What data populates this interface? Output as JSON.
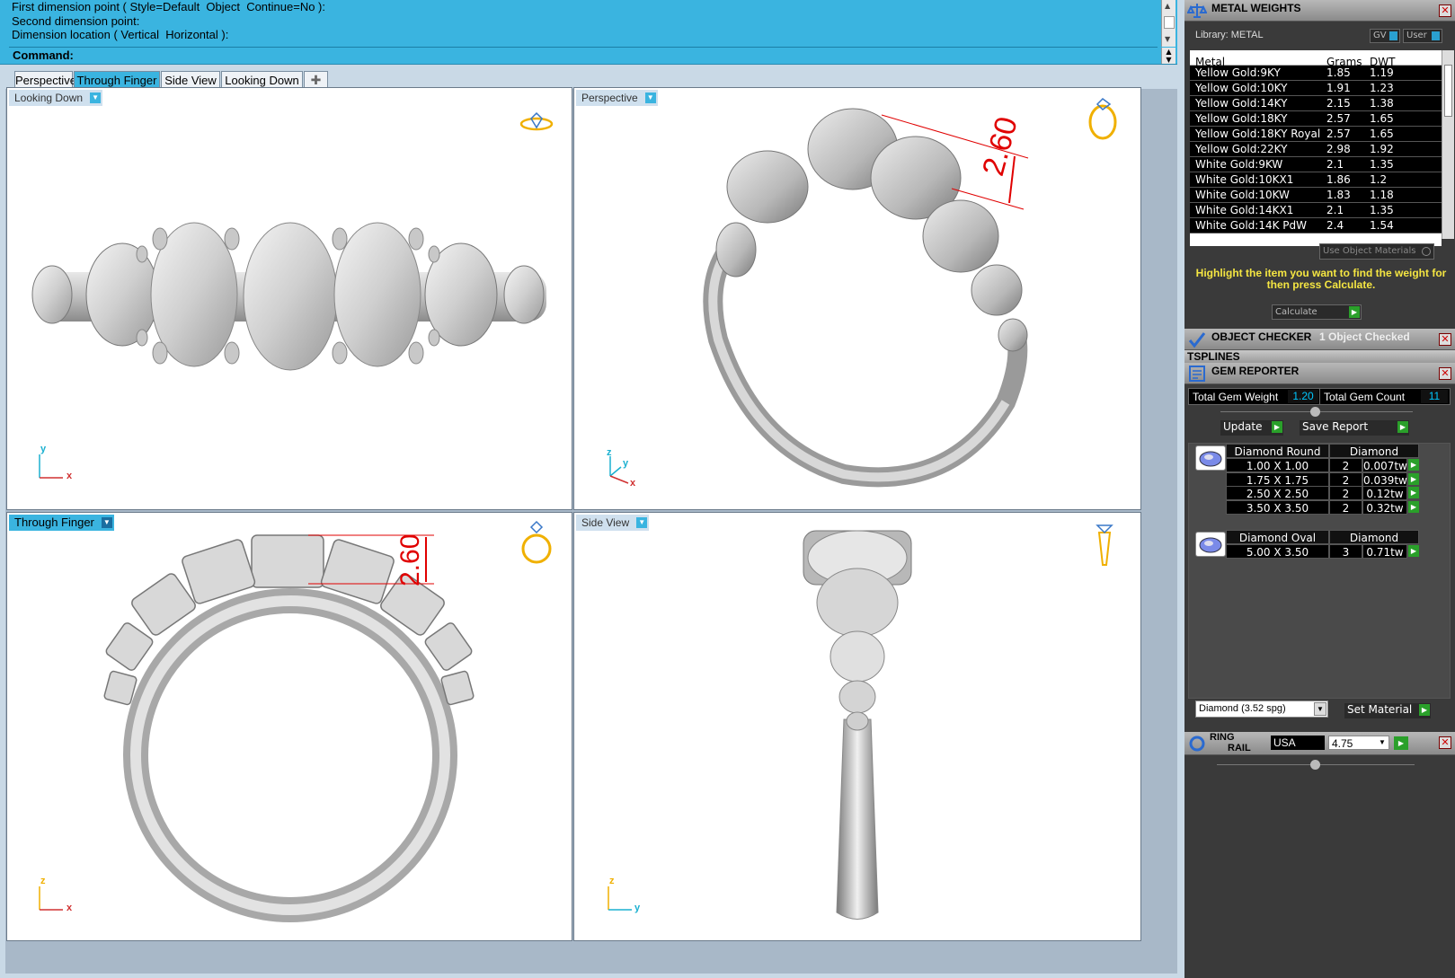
{
  "command": {
    "history": [
      "First dimension point ( Style=Default  Object  Continue=No ):",
      "Second dimension point:",
      "Dimension location ( Vertical  Horizontal ):"
    ],
    "prompt": "Command:"
  },
  "viewport_tabs": [
    "Perspective",
    "Through Finger",
    "Side View",
    "Looking Down"
  ],
  "add_tab_icon": "plus-icon",
  "viewports": {
    "top_left": {
      "label": "Looking Down",
      "axis_a": "y",
      "axis_b": "x"
    },
    "top_right": {
      "label": "Perspective",
      "axis_a": "z",
      "axis_b": "y",
      "axis_c": "x",
      "dimension": "2.60"
    },
    "bottom_left": {
      "label": "Through Finger",
      "axis_a": "z",
      "axis_b": "x",
      "dimension": "2.60"
    },
    "bottom_right": {
      "label": "Side View",
      "axis_a": "z",
      "axis_b": "y"
    }
  },
  "metal_weights": {
    "title": "METAL WEIGHTS",
    "library_label": "Library: METAL",
    "gv_label": "GV",
    "user_label": "User",
    "columns": [
      "Metal",
      "Grams",
      "DWT"
    ],
    "rows": [
      [
        "Yellow Gold:9KY",
        "1.85",
        "1.19"
      ],
      [
        "Yellow Gold:10KY",
        "1.91",
        "1.23"
      ],
      [
        "Yellow Gold:14KY",
        "2.15",
        "1.38"
      ],
      [
        "Yellow Gold:18KY",
        "2.57",
        "1.65"
      ],
      [
        "Yellow Gold:18KY Royal",
        "2.57",
        "1.65"
      ],
      [
        "Yellow Gold:22KY",
        "2.98",
        "1.92"
      ],
      [
        "White Gold:9KW",
        "2.1",
        "1.35"
      ],
      [
        "White Gold:10KX1",
        "1.86",
        "1.2"
      ],
      [
        "White Gold:10KW",
        "1.83",
        "1.18"
      ],
      [
        "White Gold:14KX1",
        "2.1",
        "1.35"
      ],
      [
        "White Gold:14K PdW",
        "2.4",
        "1.54"
      ]
    ],
    "use_object_materials": "Use Object Materials",
    "instruction": "Highlight the item you want to find the weight for then press Calculate.",
    "calculate_label": "Calculate"
  },
  "object_checker": {
    "title": "OBJECT CHECKER",
    "status": "1  Object Checked"
  },
  "tsplines": {
    "title": "TSPLINES"
  },
  "gem_reporter": {
    "title": "GEM REPORTER",
    "total_weight_label": "Total Gem Weight",
    "total_weight_value": "1.20",
    "total_count_label": "Total Gem Count",
    "total_count_value": "11",
    "update_label": "Update",
    "save_report_label": "Save Report",
    "groups": [
      {
        "shape": "Diamond Round",
        "material": "Diamond",
        "rows": [
          [
            "1.00 X 1.00",
            "2",
            "0.007tw"
          ],
          [
            "1.75 X 1.75",
            "2",
            "0.039tw"
          ],
          [
            "2.50 X 2.50",
            "2",
            "0.12tw"
          ],
          [
            "3.50 X 3.50",
            "2",
            "0.32tw"
          ]
        ]
      },
      {
        "shape": "Diamond Oval",
        "material": "Diamond",
        "rows": [
          [
            "5.00 X 3.50",
            "3",
            "0.71tw"
          ]
        ]
      }
    ],
    "material_select": "Diamond     (3.52 spg)",
    "set_material_label": "Set Material"
  },
  "ring_rail": {
    "title_line1": "RING",
    "title_line2": "RAIL",
    "region": "USA",
    "size": "4.75"
  },
  "colors": {
    "command_bg": "#3ab4e0",
    "panel_bg": "#3a3a3a",
    "highlight_text": "#f5e642",
    "dimension_red": "#e00000",
    "gold_icon": "#f0b000",
    "cyan_value": "#00c8ff"
  }
}
